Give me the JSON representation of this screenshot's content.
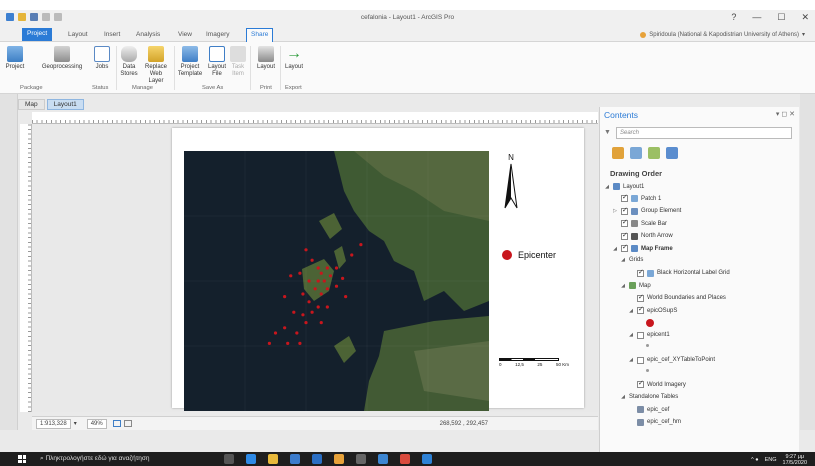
{
  "window": {
    "title": "cefalonia - Layout1 - ArcGIS Pro",
    "controls": [
      "?",
      "—",
      "☐",
      "✕"
    ]
  },
  "user": {
    "name": "Spiridoula (National & Kapodistrian University of Athens)"
  },
  "ribbon": {
    "tabs": [
      "Project",
      "Layout",
      "Insert",
      "Analysis",
      "View",
      "Imagery",
      "Share"
    ],
    "active_tab": "Share",
    "buttons": [
      {
        "label": "Project",
        "icon": "project-package-icon"
      },
      {
        "label": "Geoprocessing",
        "icon": "geoprocessing-package-icon"
      },
      {
        "label": "Jobs",
        "icon": "jobs-icon"
      },
      {
        "label": "Data Stores",
        "icon": "data-stores-icon"
      },
      {
        "label": "Replace Web Layer",
        "icon": "replace-web-layer-icon"
      },
      {
        "label": "Project Template",
        "icon": "project-template-icon"
      },
      {
        "label": "Layout File",
        "icon": "layout-file-icon"
      },
      {
        "label": "Task Item",
        "icon": "task-item-icon"
      },
      {
        "label": "Layout",
        "icon": "print-layout-icon"
      },
      {
        "label": "Layout",
        "icon": "export-layout-icon"
      }
    ],
    "groups": [
      "Package",
      "Status",
      "Manage",
      "Save As",
      "Print",
      "Export"
    ]
  },
  "view_tabs": [
    {
      "label": "Map"
    },
    {
      "label": "Layout1"
    }
  ],
  "layout": {
    "legend_label": "Epicenter",
    "north_arrow": "N",
    "scale_bar_labels": [
      "0",
      "12,5",
      "25",
      "50 Km"
    ],
    "epicenter_points": [
      [
        0.4,
        0.38
      ],
      [
        0.42,
        0.42
      ],
      [
        0.44,
        0.45
      ],
      [
        0.45,
        0.47
      ],
      [
        0.47,
        0.45
      ],
      [
        0.48,
        0.48
      ],
      [
        0.46,
        0.5
      ],
      [
        0.44,
        0.5
      ],
      [
        0.43,
        0.53
      ],
      [
        0.45,
        0.55
      ],
      [
        0.47,
        0.53
      ],
      [
        0.5,
        0.52
      ],
      [
        0.52,
        0.49
      ],
      [
        0.5,
        0.45
      ],
      [
        0.41,
        0.5
      ],
      [
        0.38,
        0.47
      ],
      [
        0.39,
        0.55
      ],
      [
        0.41,
        0.58
      ],
      [
        0.36,
        0.62
      ],
      [
        0.39,
        0.63
      ],
      [
        0.42,
        0.62
      ],
      [
        0.44,
        0.6
      ],
      [
        0.4,
        0.66
      ],
      [
        0.37,
        0.7
      ],
      [
        0.33,
        0.68
      ],
      [
        0.3,
        0.7
      ],
      [
        0.28,
        0.74
      ],
      [
        0.34,
        0.74
      ],
      [
        0.38,
        0.74
      ],
      [
        0.45,
        0.66
      ],
      [
        0.47,
        0.6
      ],
      [
        0.55,
        0.4
      ],
      [
        0.58,
        0.36
      ],
      [
        0.35,
        0.48
      ],
      [
        0.33,
        0.56
      ],
      [
        0.53,
        0.56
      ]
    ],
    "epicenter_color": "#c8161d"
  },
  "statusbar": {
    "scale": "1:913,328",
    "zoom": "49%",
    "coords": "268,592 , 292,457"
  },
  "contents": {
    "title": "Contents",
    "search_placeholder": "Search",
    "heading": "Drawing Order",
    "items": [
      {
        "label": "Layout1",
        "level": 0,
        "check": false,
        "icon": "layout-icon",
        "expanded": true
      },
      {
        "label": "Patch 1",
        "level": 1,
        "check": true,
        "icon": "patch-icon"
      },
      {
        "label": "Group Element",
        "level": 1,
        "check": true,
        "icon": "group-element-icon",
        "collapsed": true
      },
      {
        "label": "Scale Bar",
        "level": 1,
        "check": true,
        "icon": "scale-bar-icon"
      },
      {
        "label": "North Arrow",
        "level": 1,
        "check": true,
        "icon": "north-arrow-icon"
      },
      {
        "label": "Map Frame",
        "level": 1,
        "check": true,
        "icon": "map-frame-icon",
        "bold": true,
        "expanded": true
      },
      {
        "label": "Grids",
        "level": 2,
        "check": false,
        "icon": "",
        "expanded": true
      },
      {
        "label": "Black Horizontal Label Grid",
        "level": 3,
        "check": true,
        "icon": "grid-icon"
      },
      {
        "label": "Map",
        "level": 2,
        "check": false,
        "icon": "map-icon",
        "expanded": true
      },
      {
        "label": "World Boundaries and Places",
        "level": 3,
        "check": true,
        "icon": ""
      },
      {
        "label": "epicOSupS",
        "level": 3,
        "check": true,
        "icon": "",
        "expanded": true
      },
      {
        "label": "",
        "level": 4,
        "symbol": "red-dot"
      },
      {
        "label": "epicent1",
        "level": 3,
        "check": false,
        "icon": "",
        "expanded": true
      },
      {
        "label": "",
        "level": 4,
        "symbol": "grey-dot"
      },
      {
        "label": "epic_cef_XYTableToPoint",
        "level": 3,
        "check": false,
        "icon": "",
        "expanded": true
      },
      {
        "label": "",
        "level": 4,
        "symbol": "grey-dot"
      },
      {
        "label": "World Imagery",
        "level": 3,
        "check": true,
        "icon": ""
      },
      {
        "label": "Standalone Tables",
        "level": 2,
        "check": false,
        "icon": "",
        "expanded": true
      },
      {
        "label": "epic_cef",
        "level": 3,
        "check": false,
        "icon": "table-icon"
      },
      {
        "label": "epic_cef_hm",
        "level": 3,
        "check": false,
        "icon": "table-icon"
      }
    ]
  },
  "taskbar": {
    "search_text": "Πληκτρολογήστε εδώ για αναζήτηση",
    "language": "ENG",
    "time": "9:27 μμ",
    "date": "17/5/2020"
  }
}
